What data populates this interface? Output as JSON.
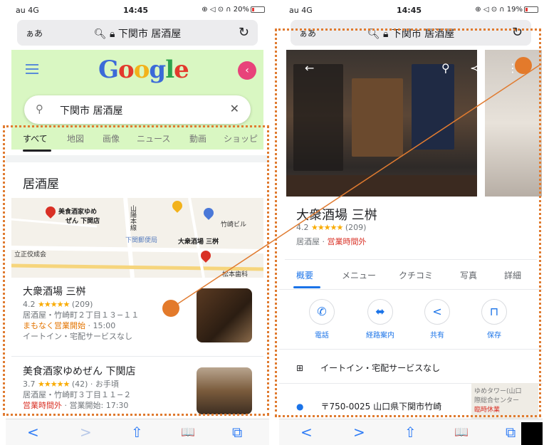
{
  "left_phone": {
    "status": {
      "carrier": "au 4G",
      "time": "14:45",
      "battery": "20%",
      "battery_fraction": 0.2,
      "icons": "⊕ ◁ ⊙ ∩"
    },
    "url_bar": {
      "aa": "ぁあ",
      "url": "下関市 居酒屋",
      "lock_icon": "lock-icon",
      "reload_icon": "reload-icon"
    },
    "header": {
      "menu_icon": "hamburger-icon",
      "logo": "Google",
      "share_icon": "share-icon"
    },
    "search": {
      "query": "下関市 居酒屋",
      "clear_icon": "close-icon"
    },
    "tabs": [
      "すべて",
      "地図",
      "画像",
      "ニュース",
      "動画",
      "ショッピ"
    ],
    "section_title": "居酒屋",
    "map": {
      "labels": [
        "美食酒家ゆめ",
        "ぜん 下関店",
        "下関郵便局",
        "大衆酒場 三桝",
        "竹崎ビル",
        "立正佼成会",
        "山陽本線",
        "松本歯科"
      ]
    },
    "results": [
      {
        "name": "大衆酒場 三桝",
        "rating": "4.2",
        "stars": "★★★★★",
        "reviews": "(209)",
        "address": "居酒屋・竹崎町２丁目１３−１１",
        "status": "まもなく営業開始",
        "status_time": "· 15:00",
        "services": "イートイン・宅配サービスなし"
      },
      {
        "name": "美食酒家ゆめぜん 下関店",
        "rating": "3.7",
        "stars": "★★★★★",
        "reviews": "(42)",
        "price": "· お手頃",
        "address": "居酒屋・竹崎町３丁目１１−２",
        "status": "営業時間外",
        "status_time": "· 営業開始: 17:30"
      }
    ],
    "toolbar": [
      "<",
      ">",
      "⇧",
      "📖",
      "⧉"
    ]
  },
  "right_phone": {
    "status": {
      "carrier": "au 4G",
      "time": "14:45",
      "battery": "19%",
      "battery_fraction": 0.19,
      "icons": "⊕ ◁ ⊙ ∩"
    },
    "url_bar": {
      "aa": "ぁあ",
      "url": "下関市 居酒屋"
    },
    "place": {
      "name": "大衆酒場 三桝",
      "rating": "4.2",
      "stars": "★★★★★",
      "reviews": "(209)",
      "type": "居酒屋",
      "status": "営業時間外"
    },
    "tabs": [
      "概要",
      "メニュー",
      "クチコミ",
      "写真",
      "詳細"
    ],
    "actions": [
      {
        "label": "電話",
        "icon": "phone-icon",
        "glyph": "✆"
      },
      {
        "label": "経路案内",
        "icon": "directions-icon",
        "glyph": "⬌"
      },
      {
        "label": "共有",
        "icon": "share-icon",
        "glyph": "<"
      },
      {
        "label": "保存",
        "icon": "bookmark-icon",
        "glyph": "⊓"
      }
    ],
    "feature": "イートイン・宅配サービスなし",
    "address": "〒750-0025 山口県下関市竹崎",
    "mini_map_label": "ゆめタワー(山口",
    "mini_map_label2": "際総合センター",
    "mini_map_label3": "臨時休業",
    "toolbar": [
      "<",
      ">",
      "⇧",
      "📖",
      "⧉"
    ]
  },
  "annotation_color": "#e07b30"
}
